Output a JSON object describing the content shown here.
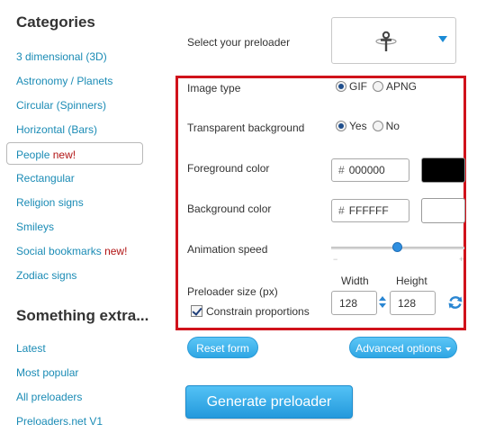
{
  "sidebar": {
    "categories_heading": "Categories",
    "categories": [
      {
        "label": "3 dimensional (3D)",
        "badge": ""
      },
      {
        "label": "Astronomy / Planets",
        "badge": ""
      },
      {
        "label": "Circular (Spinners)",
        "badge": ""
      },
      {
        "label": "Horizontal (Bars)",
        "badge": ""
      },
      {
        "label": "People",
        "badge": "new!",
        "active": true
      },
      {
        "label": "Rectangular",
        "badge": ""
      },
      {
        "label": "Religion signs",
        "badge": ""
      },
      {
        "label": "Smileys",
        "badge": ""
      },
      {
        "label": "Social bookmarks",
        "badge": "new!"
      },
      {
        "label": "Zodiac signs",
        "badge": ""
      }
    ],
    "extra_heading": "Something extra...",
    "extra": [
      {
        "label": "Latest"
      },
      {
        "label": "Most popular"
      },
      {
        "label": "All preloaders"
      },
      {
        "label": "Preloaders.net V1"
      }
    ]
  },
  "form": {
    "select_label": "Select your preloader",
    "preloader_icon": "ankh-religion-icon",
    "image_type": {
      "label": "Image type",
      "options": [
        "GIF",
        "APNG"
      ],
      "selected": "GIF"
    },
    "transparent": {
      "label": "Transparent background",
      "options": [
        "Yes",
        "No"
      ],
      "selected": "Yes"
    },
    "foreground": {
      "label": "Foreground color",
      "hash": "#",
      "value": "000000",
      "swatch": "#000000"
    },
    "background": {
      "label": "Background color",
      "hash": "#",
      "value": "FFFFFF",
      "swatch": "#FFFFFF"
    },
    "speed": {
      "label": "Animation speed",
      "minus": "−",
      "plus": "+",
      "level": 0.5
    },
    "size": {
      "label": "Preloader size (px)",
      "width_label": "Width",
      "height_label": "Height",
      "width": "128",
      "height": "128",
      "constrain_label": "Constrain proportions",
      "constrain_checked": true
    },
    "reset_label": "Reset form",
    "advanced_label": "Advanced options",
    "generate_label": "Generate preloader"
  },
  "colors": {
    "accent": "#2ea6e4",
    "link": "#1a8bb5",
    "highlight": "#d0121b",
    "new_badge": "#b11313"
  }
}
